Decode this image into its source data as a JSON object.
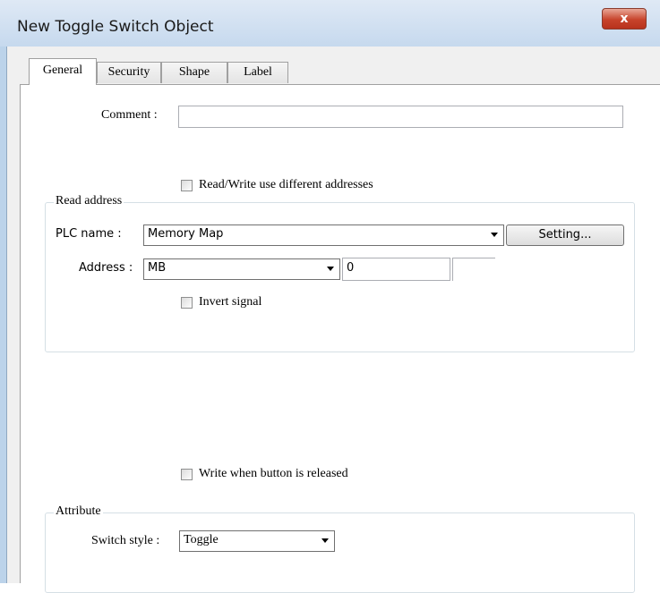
{
  "window": {
    "title": "New Toggle Switch Object",
    "close_glyph": "x"
  },
  "tabs": [
    {
      "label": "General",
      "active": true
    },
    {
      "label": "Security",
      "active": false
    },
    {
      "label": "Shape",
      "active": false
    },
    {
      "label": "Label",
      "active": false
    }
  ],
  "general": {
    "comment_label": "Comment :",
    "comment_value": "",
    "rw_diff_label": "Read/Write use different addresses",
    "rw_diff_checked": false
  },
  "read_address": {
    "legend": "Read address",
    "plc_label": "PLC name :",
    "plc_value": "Memory Map",
    "setting_label": "Setting...",
    "address_label": "Address :",
    "address_device": "MB",
    "address_value": "0",
    "address_extra": "",
    "invert_label": "Invert signal",
    "invert_checked": false
  },
  "write_when_released": {
    "label": "Write when button is released",
    "checked": false
  },
  "attribute": {
    "legend": "Attribute",
    "style_label": "Switch style :",
    "style_value": "Toggle"
  }
}
